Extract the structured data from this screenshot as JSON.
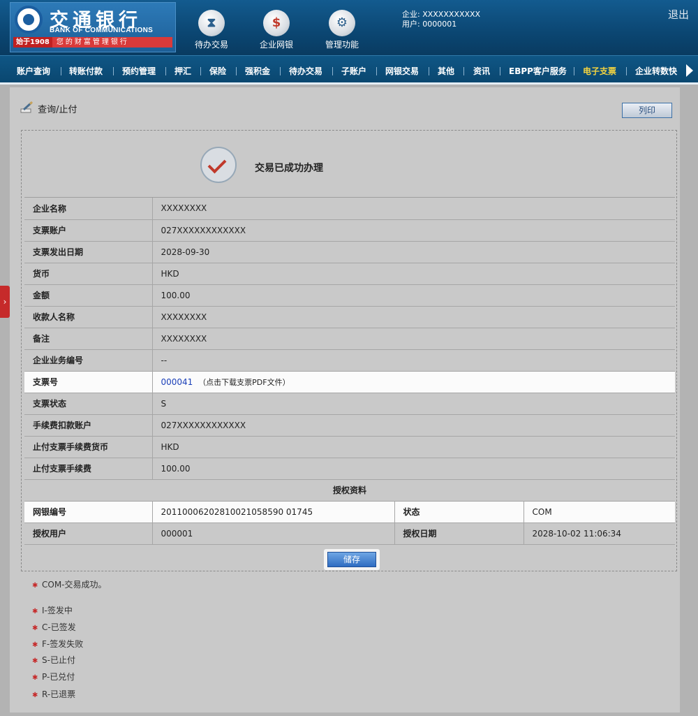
{
  "header": {
    "logo": {
      "cn": "交通银行",
      "en": "BANK OF COMMUNICATIONS",
      "since": "始于1908",
      "motto": "您的财富管理银行"
    },
    "icons": [
      {
        "label": "待办交易",
        "icon": "hourglass-icon"
      },
      {
        "label": "企业网银",
        "icon": "monitor-icon"
      },
      {
        "label": "管理功能",
        "icon": "gears-icon"
      }
    ],
    "enterprise": "企业: XXXXXXXXXXX",
    "user": "用户: 0000001",
    "logout": "退出"
  },
  "nav": {
    "items": [
      "账户查询",
      "转账付款",
      "预约管理",
      "押汇",
      "保险",
      "强积金",
      "待办交易",
      "子账户",
      "网银交易",
      "其他",
      "资讯",
      "EBPP客户服务",
      "电子支票",
      "企业转数快"
    ],
    "active": "电子支票"
  },
  "side_tab": {
    "label": "›"
  },
  "page": {
    "title": "查询/止付",
    "print_label": "列印",
    "success_text": "交易已成功办理",
    "save_label": "储存"
  },
  "details": [
    {
      "label": "企业名称",
      "value": "XXXXXXXX"
    },
    {
      "label": "支票账户",
      "value": "027XXXXXXXXXXXX"
    },
    {
      "label": "支票发出日期",
      "value": "2028-09-30"
    },
    {
      "label": "货币",
      "value": "HKD"
    },
    {
      "label": "金额",
      "value": "100.00"
    },
    {
      "label": "收款人名称",
      "value": "XXXXXXXX"
    },
    {
      "label": "备注",
      "value": "XXXXXXXX"
    },
    {
      "label": "企业业务编号",
      "value": "--"
    },
    {
      "label": "支票号",
      "value": "000041",
      "link_note": "（点击下载支票PDF文件）"
    },
    {
      "label": "支票状态",
      "value": "S"
    },
    {
      "label": "手续费扣款账户",
      "value": "027XXXXXXXXXXXX"
    },
    {
      "label": "止付支票手续费货币",
      "value": "HKD"
    },
    {
      "label": "止付支票手续费",
      "value": "100.00"
    }
  ],
  "auth": {
    "section_title": "授权资料",
    "rows": [
      {
        "label1": "网银编号",
        "value1": "20110006202810021058590 01745",
        "label2": "状态",
        "value2": "COM"
      },
      {
        "label1": "授权用户",
        "value1": "000001",
        "label2": "授权日期",
        "value2": "2028-10-02 11:06:34"
      }
    ]
  },
  "notes": [
    "COM-交易成功。",
    "I-签发中",
    "C-已签发",
    "F-签发失败",
    "S-已止付",
    "P-已兑付",
    "R-已退票"
  ]
}
